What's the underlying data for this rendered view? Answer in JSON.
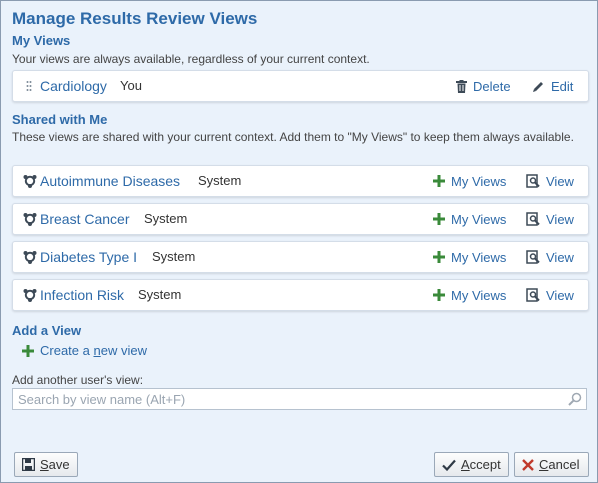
{
  "dialog": {
    "title": "Manage Results Review Views"
  },
  "my_views": {
    "heading": "My Views",
    "description": "Your views are always available, regardless of your current context.",
    "items": [
      {
        "name": "Cardiology",
        "owner": "You",
        "delete_label": "Delete",
        "edit_label": "Edit"
      }
    ]
  },
  "shared": {
    "heading": "Shared with Me",
    "description": "These views are shared with your current context. Add them to \"My Views\" to keep them always available.",
    "add_label": "My Views",
    "view_label": "View",
    "items": [
      {
        "name": "Autoimmune Diseases",
        "owner": "System"
      },
      {
        "name": "Breast Cancer",
        "owner": "System"
      },
      {
        "name": "Diabetes Type I",
        "owner": "System"
      },
      {
        "name": "Infection Risk",
        "owner": "System"
      }
    ]
  },
  "add_view": {
    "heading": "Add a View",
    "create_prefix": "Create a ",
    "create_underlined": "n",
    "create_suffix": "ew view",
    "other_user_label": "Add another user's view:",
    "search_placeholder": "Search by view name (Alt+F)"
  },
  "footer": {
    "save_u": "S",
    "save_rest": "ave",
    "accept_u": "A",
    "accept_rest": "ccept",
    "cancel_u": "C",
    "cancel_rest": "ancel"
  },
  "colors": {
    "accent": "#2e6aa8",
    "background": "#eaf2fb",
    "add_green": "#3a8a3a",
    "cancel_red": "#c0392b"
  },
  "icons": {
    "drag": "drag-handle-icon",
    "delete": "trash-icon",
    "edit": "pencil-icon",
    "shared_item": "shared-view-icon",
    "add": "plus-icon",
    "view": "magnify-doc-icon",
    "search": "search-icon",
    "save": "floppy-icon",
    "accept": "checkmark-icon",
    "cancel": "x-icon"
  }
}
